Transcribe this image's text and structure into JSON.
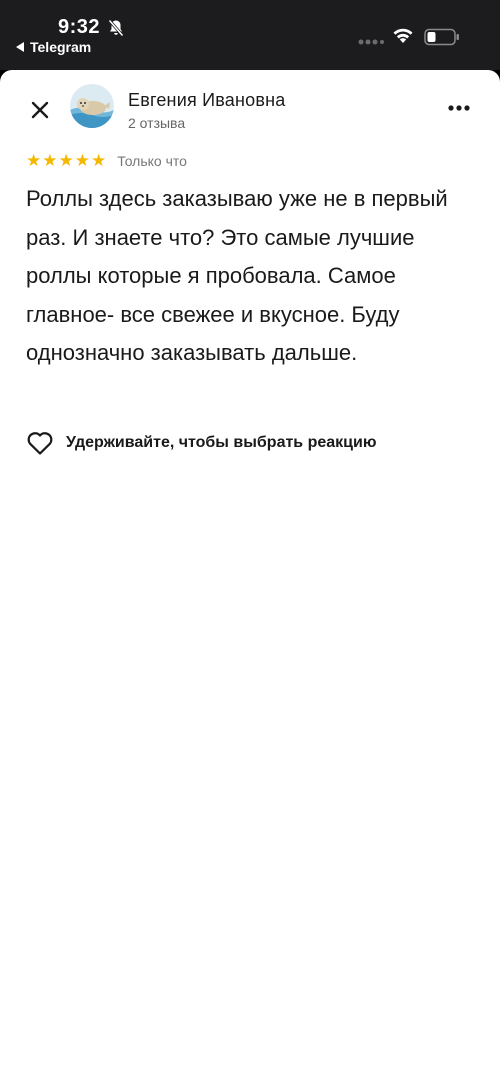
{
  "status_bar": {
    "time": "9:32",
    "back_app": "Telegram",
    "icons": [
      "bell-off-icon",
      "signal-dots-icon",
      "wifi-icon",
      "battery-icon"
    ]
  },
  "review": {
    "author": {
      "name": "Евгения Ивановна",
      "reviews_count": "2 отзыва",
      "avatar_icon": "seal-avatar"
    },
    "rating": 5,
    "stars": [
      "★",
      "★",
      "★",
      "★",
      "★"
    ],
    "timestamp": "Только что",
    "text": "Роллы здесь заказываю уже не в первый раз. И знаете что? Это самые лучшие роллы которые я пробовала. Самое главное- все свежее и вкусное. Буду однозначно заказывать дальше.",
    "reaction_hint": "Удерживайте, чтобы выбрать реакцию"
  },
  "colors": {
    "star": "#f5b800",
    "sheet_background": "#ffffff",
    "status_bar_background": "#1c1c1e",
    "text_primary": "#1a1a1a",
    "text_secondary": "#666666"
  }
}
